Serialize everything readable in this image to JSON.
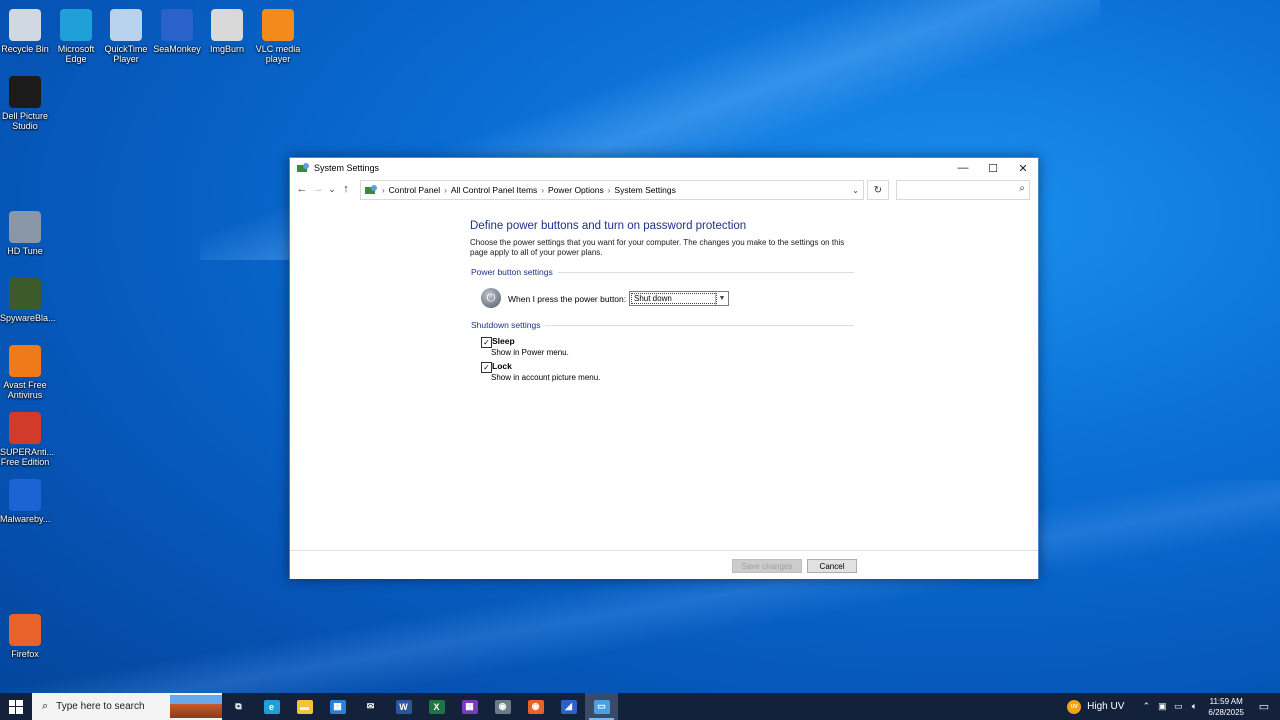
{
  "desktop": {
    "icons": [
      {
        "name": "Recycle Bin",
        "color": "#cfd8e3"
      },
      {
        "name": "Microsoft Edge",
        "color": "#1fa0d8"
      },
      {
        "name": "QuickTime Player",
        "color": "#b9d3ef"
      },
      {
        "name": "SeaMonkey",
        "color": "#2a62c9"
      },
      {
        "name": "ImgBurn",
        "color": "#d9d9d9"
      },
      {
        "name": "VLC media player",
        "color": "#f28a1c"
      },
      {
        "name": "Dell Picture Studio",
        "color": "#1b1b1b"
      },
      {
        "name": "HD Tune",
        "color": "#8a97a8"
      },
      {
        "name": "SpywareBla...",
        "color": "#3c5a2a"
      },
      {
        "name": "Avast Free Antivirus",
        "color": "#f07a1a"
      },
      {
        "name": "SUPERAnti... Free Edition",
        "color": "#d23a2a"
      },
      {
        "name": "Malwareby...",
        "color": "#1a64d6"
      },
      {
        "name": "Firefox",
        "color": "#e8622a"
      }
    ]
  },
  "window": {
    "title": "System Settings",
    "controls": {
      "minimize": "—",
      "maximize": "☐",
      "close": "✕"
    },
    "nav": {
      "back": "←",
      "forward": "→",
      "recent": "⌄",
      "up": "↑"
    },
    "breadcrumb": [
      "Control Panel",
      "All Control Panel Items",
      "Power Options",
      "System Settings"
    ],
    "breadcrumb_sep": "›",
    "address_dropdown": "⌄",
    "refresh": "↻",
    "search_placeholder": "",
    "search_icon": "⌕",
    "heading": "Define power buttons and turn on password protection",
    "description": "Choose the power settings that you want for your computer. The changes you make to the settings on this page apply to all of your power plans.",
    "power_section": "Power button settings",
    "power_label": "When I press the power button:",
    "power_value": "Shut down",
    "shutdown_section": "Shutdown settings",
    "options": [
      {
        "label": "Sleep",
        "desc": "Show in Power menu.",
        "checked": true
      },
      {
        "label": "Lock",
        "desc": "Show in account picture menu.",
        "checked": true
      }
    ],
    "check_mark": "✓",
    "save_button": "Save changes",
    "cancel_button": "Cancel"
  },
  "taskbar": {
    "search_placeholder": "Type here to search",
    "apps": [
      {
        "name": "task-view",
        "glyph": "⧉",
        "color": "transparent",
        "active": false
      },
      {
        "name": "edge",
        "glyph": "e",
        "color": "#1fa0d8",
        "active": false
      },
      {
        "name": "file-explorer",
        "glyph": "▬",
        "color": "#f3c33c",
        "active": false
      },
      {
        "name": "store",
        "glyph": "▦",
        "color": "#2a7fd6",
        "active": false
      },
      {
        "name": "mail",
        "glyph": "✉",
        "color": "transparent",
        "active": false
      },
      {
        "name": "word",
        "glyph": "W",
        "color": "#2b579a",
        "active": false
      },
      {
        "name": "excel",
        "glyph": "X",
        "color": "#217346",
        "active": false
      },
      {
        "name": "app-multi",
        "glyph": "▦",
        "color": "#7a3ab8",
        "active": false
      },
      {
        "name": "seamonkey",
        "glyph": "◉",
        "color": "#6c7a8a",
        "active": false
      },
      {
        "name": "firefox",
        "glyph": "◉",
        "color": "#e8622a",
        "active": false
      },
      {
        "name": "seamonkey-2",
        "glyph": "◢",
        "color": "#2a62c9",
        "active": false
      },
      {
        "name": "control-panel",
        "glyph": "▭",
        "color": "#4aa0e0",
        "active": true
      }
    ],
    "weather": {
      "badge": "UV",
      "text": "High UV"
    },
    "time": "11:59 AM",
    "date": "6/28/2025"
  }
}
